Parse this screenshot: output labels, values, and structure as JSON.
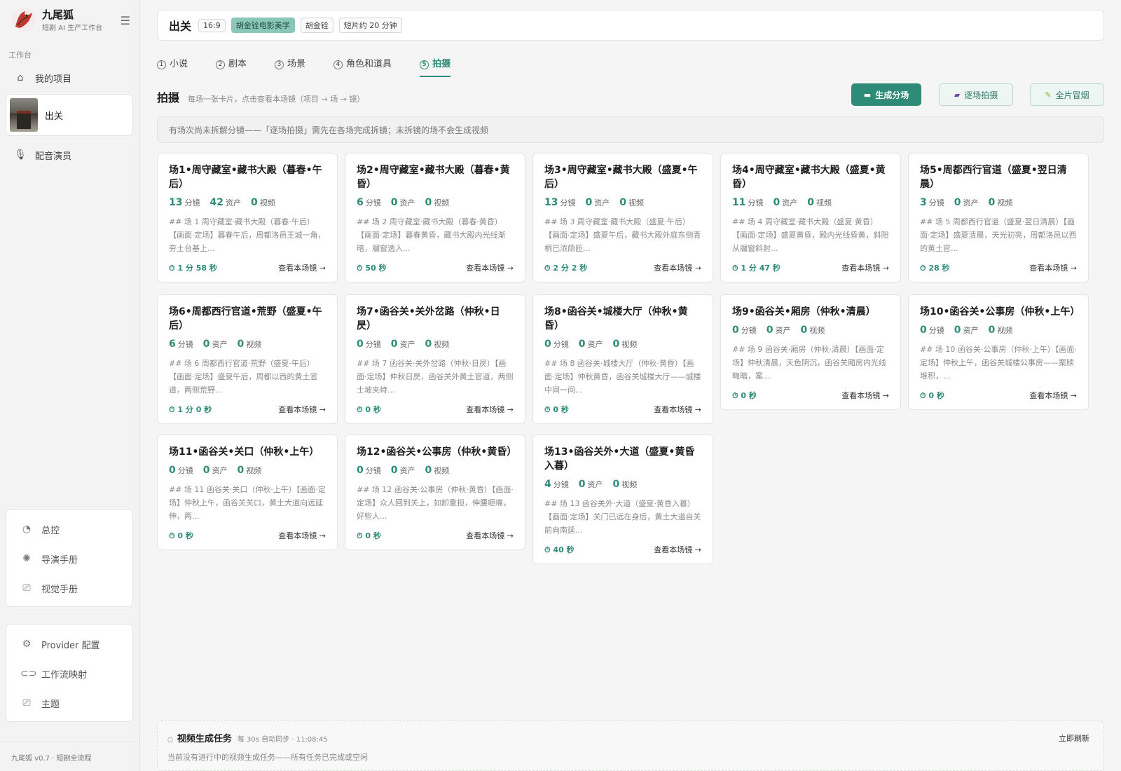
{
  "brand": {
    "name": "九尾狐",
    "subtitle": "短剧 AI 生产工作台",
    "version": "九尾狐 v0.7 · 短剧全流程"
  },
  "sidebar": {
    "section_label": "工作台",
    "my_projects": "我的项目",
    "project_name": "出关",
    "voice_actors": "配音演员",
    "panel1": [
      "总控",
      "导演手册",
      "视觉手册"
    ],
    "panel2": [
      "Provider 配置",
      "工作流映射",
      "主题"
    ]
  },
  "topbar": {
    "title": "出关",
    "tags": [
      "16:9",
      "胡金铨电影美学",
      "胡金铨",
      "短片约 20 分钟"
    ]
  },
  "tabs": [
    {
      "num": "1",
      "label": "小说"
    },
    {
      "num": "2",
      "label": "剧本"
    },
    {
      "num": "3",
      "label": "场景"
    },
    {
      "num": "4",
      "label": "角色和道具"
    },
    {
      "num": "5",
      "label": "拍摄"
    }
  ],
  "section": {
    "title": "拍摄",
    "subtitle": "每场一张卡片，点击查看本场镜（项目 → 场 → 镜）",
    "btn_generate": "生成分场",
    "btn_per_scene": "逐场拍摄",
    "btn_smoke": "全片冒烟"
  },
  "notice": "有场次尚未拆解分镜——「逐场拍摄」需先在各场完成拆镜；未拆镜的场不会生成视频",
  "labels": {
    "shots": "分镜",
    "assets": "资产",
    "videos": "视频",
    "view": "查看本场镜 →"
  },
  "scenes": [
    {
      "title": "场1•周守藏室•藏书大殿（暮春•午后）",
      "shots": 13,
      "assets": 42,
      "videos": 0,
      "desc": "## 场 1 周守藏室·藏书大殿（暮春·午后）【画面·定场】暮春午后，周都洛邑王城一角，夯土台基上...",
      "duration": "1 分 58 秒"
    },
    {
      "title": "场2•周守藏室•藏书大殿（暮春•黄昏）",
      "shots": 6,
      "assets": 0,
      "videos": 0,
      "desc": "## 场 2 周守藏室·藏书大殿（暮春·黄昏）【画面·定场】暮春黄昏，藏书大殿内光线渐暗，牖窗透入...",
      "duration": "50 秒"
    },
    {
      "title": "场3•周守藏室•藏书大殿（盛夏•午后）",
      "shots": 13,
      "assets": 0,
      "videos": 0,
      "desc": "## 场 3 周守藏室·藏书大殿（盛夏·午后）【画面·定场】盛夏午后，藏书大殿外庭东侧青桐已浓荫匝...",
      "duration": "2 分 2 秒"
    },
    {
      "title": "场4•周守藏室•藏书大殿（盛夏•黄昏）",
      "shots": 11,
      "assets": 0,
      "videos": 0,
      "desc": "## 场 4 周守藏室·藏书大殿（盛夏·黄昏）【画面·定场】盛夏黄昏，殿内光线昏黄，斜阳从牖窗斜射...",
      "duration": "1 分 47 秒"
    },
    {
      "title": "场5•周都西行官道（盛夏•翌日清晨）",
      "shots": 3,
      "assets": 0,
      "videos": 0,
      "desc": "## 场 5 周都西行官道（盛夏·翌日清晨）【画面·定场】盛夏清晨，天光初亮，周都洛邑以西的黄土官...",
      "duration": "28 秒"
    },
    {
      "title": "场6•周都西行官道•荒野（盛夏•午后）",
      "shots": 6,
      "assets": 0,
      "videos": 0,
      "desc": "## 场 6 周都西行官道·荒野（盛夏·午后）【画面·定场】盛夏午后，周都以西的黄土官道，两侧荒野...",
      "duration": "1 分 0 秒"
    },
    {
      "title": "场7•函谷关•关外岔路（仲秋•日昃）",
      "shots": 0,
      "assets": 0,
      "videos": 0,
      "desc": "## 场 7 函谷关·关外岔路（仲秋·日昃）【画面·定场】仲秋日昃，函谷关外黄土官道，两侧土坡夹峙...",
      "duration": "0 秒"
    },
    {
      "title": "场8•函谷关•城楼大厅（仲秋•黄昏）",
      "shots": 0,
      "assets": 0,
      "videos": 0,
      "desc": "## 场 8 函谷关·城楼大厅（仲秋·黄昏）【画面·定场】仲秋黄昏，函谷关城楼大厅——城楼中间一间...",
      "duration": "0 秒"
    },
    {
      "title": "场9•函谷关•厢房（仲秋•清晨）",
      "shots": 0,
      "assets": 0,
      "videos": 0,
      "desc": "## 场 9 函谷关·厢房（仲秋·清晨）【画面·定场】仲秋清晨，天色阴沉，函谷关厢房内光线晦暗，案...",
      "duration": "0 秒"
    },
    {
      "title": "场10•函谷关•公事房（仲秋•上午）",
      "shots": 0,
      "assets": 0,
      "videos": 0,
      "desc": "## 场 10 函谷关·公事房（仲秋·上午）【画面·定场】仲秋上午，函谷关城楼公事房——案牍堆积，...",
      "duration": "0 秒"
    },
    {
      "title": "场11•函谷关•关口（仲秋•上午）",
      "shots": 0,
      "assets": 0,
      "videos": 0,
      "desc": "## 场 11 函谷关·关口（仲秋·上午）【画面·定场】仲秋上午，函谷关关口，黄土大道向远延伸，两...",
      "duration": "0 秒"
    },
    {
      "title": "场12•函谷关•公事房（仲秋•黄昏）",
      "shots": 0,
      "assets": 0,
      "videos": 0,
      "desc": "## 场 12 函谷关·公事房（仲秋·黄昏）【画面·定场】众人回到关上，如卸重担，伸腰咂嘴，好些人...",
      "duration": "0 秒"
    },
    {
      "title": "场13•函谷关外•大道（盛夏•黄昏入暮）",
      "shots": 4,
      "assets": 0,
      "videos": 0,
      "desc": "## 场 13 函谷关外·大道（盛夏·黄昏入暮）【画面·定场】关门已远在身后，黄土大道自关前向南延...",
      "duration": "40 秒"
    }
  ],
  "tasks": {
    "title": "视频生成任务",
    "meta": "每 30s 自动同步 · 11:08:45",
    "refresh": "立即刷新",
    "empty": "当前没有进行中的视频生成任务——所有任务已完成或空闲"
  }
}
